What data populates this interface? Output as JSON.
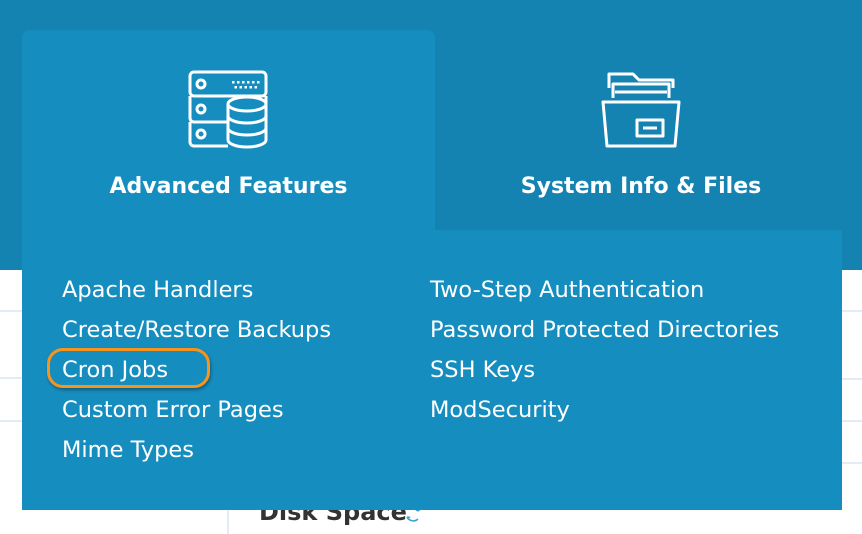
{
  "tabs": [
    {
      "label": "Advanced Features",
      "icon": "server-database-icon",
      "active": true
    },
    {
      "label": "System Info & Files",
      "icon": "folder-files-icon",
      "active": false
    }
  ],
  "menu": {
    "left_column": [
      {
        "label": "Apache Handlers"
      },
      {
        "label": "Create/Restore Backups"
      },
      {
        "label": "Cron Jobs",
        "highlighted": true
      },
      {
        "label": "Custom Error Pages"
      },
      {
        "label": "Mime Types"
      }
    ],
    "right_column": [
      {
        "label": "Two-Step Authentication"
      },
      {
        "label": "Password Protected Directories"
      },
      {
        "label": "SSH Keys"
      },
      {
        "label": "ModSecurity"
      }
    ]
  },
  "background": {
    "section_title": "Disk Space",
    "section_icon": "refresh-icon"
  },
  "colors": {
    "header_bg": "#1483b1",
    "active_panel_bg": "#168dbf",
    "highlight": "#f7941d",
    "text": "#ffffff"
  }
}
